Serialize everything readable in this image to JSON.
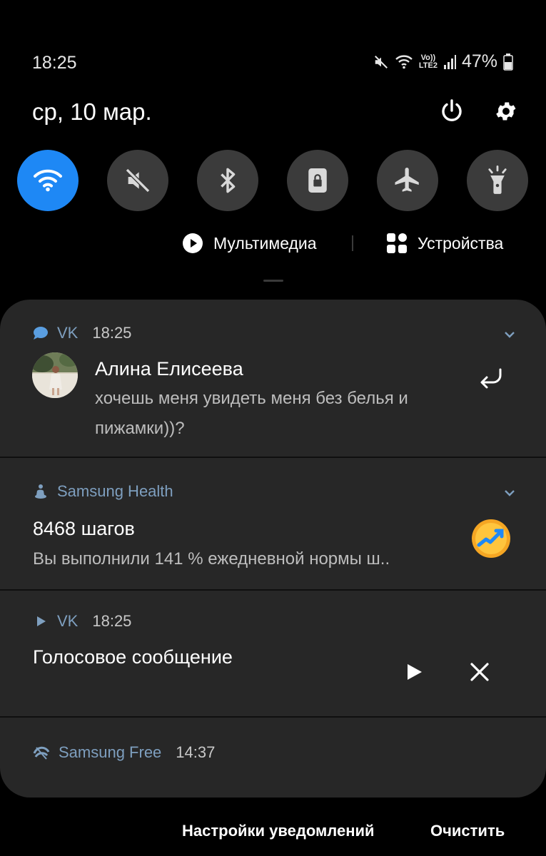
{
  "status_bar": {
    "time": "18:25",
    "volte_top": "Vo))",
    "volte_bottom": "LTE2",
    "battery": "47%"
  },
  "header": {
    "date": "ср, 10 мар.",
    "power_icon": "power-icon",
    "settings_icon": "gear-icon"
  },
  "quick_settings": [
    {
      "icon": "wifi-icon",
      "active": true
    },
    {
      "icon": "mute-icon",
      "active": false
    },
    {
      "icon": "bluetooth-icon",
      "active": false
    },
    {
      "icon": "rotation-lock-icon",
      "active": false
    },
    {
      "icon": "airplane-icon",
      "active": false
    },
    {
      "icon": "flashlight-icon",
      "active": false
    }
  ],
  "media": {
    "multimedia_label": "Мультимедиа",
    "devices_label": "Устройства"
  },
  "notifications": [
    {
      "app": "VK",
      "time": "18:25",
      "title": "Алина Елисеева",
      "body_line1": "хочешь меня увидеть меня без белья и",
      "body_line2": "пижамки))?"
    },
    {
      "app": "Samsung Health",
      "title": "8468 шагов",
      "body": "Вы выполнили 141 % ежедневной нормы ш.."
    },
    {
      "app": "VK",
      "time": "18:25",
      "title": "Голосовое сообщение"
    },
    {
      "app": "Samsung Free",
      "time": "14:37"
    }
  ],
  "footer": {
    "settings_label": "Настройки уведомлений",
    "clear_label": "Очистить"
  },
  "colors": {
    "accent": "#1e88f5",
    "panel": "#272727",
    "app_name": "#7e9fbf"
  }
}
